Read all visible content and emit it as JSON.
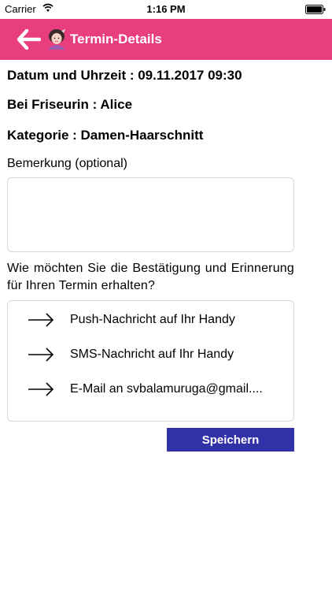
{
  "status_bar": {
    "carrier": "Carrier",
    "time": "1:16 PM"
  },
  "header": {
    "title": "Termin-Details",
    "background_color": "#e83e7e",
    "back_icon": "back-arrow-icon",
    "avatar_icon": "stylist-avatar-icon"
  },
  "details": {
    "date_time": "Datum und Uhrzeit : 09.11.2017 09:30",
    "stylist": "Bei Friseurin : Alice",
    "category": "Kategorie : Damen-Haarschnitt"
  },
  "remark": {
    "label": "Bemerkung (optional)",
    "value": ""
  },
  "notification": {
    "question": "Wie möchten Sie die Bestätigung und Erinnerung für Ihren Termin erhalten?",
    "options": [
      {
        "label": "Push-Nachricht auf Ihr Handy",
        "icon": "arrow-right-icon"
      },
      {
        "label": "SMS-Nachricht auf Ihr Handy",
        "icon": "arrow-right-icon"
      },
      {
        "label": "E-Mail an svbalamuruga@gmail....",
        "icon": "arrow-right-icon"
      }
    ]
  },
  "save_button": {
    "label": "Speichern",
    "background_color": "#3232a8"
  }
}
